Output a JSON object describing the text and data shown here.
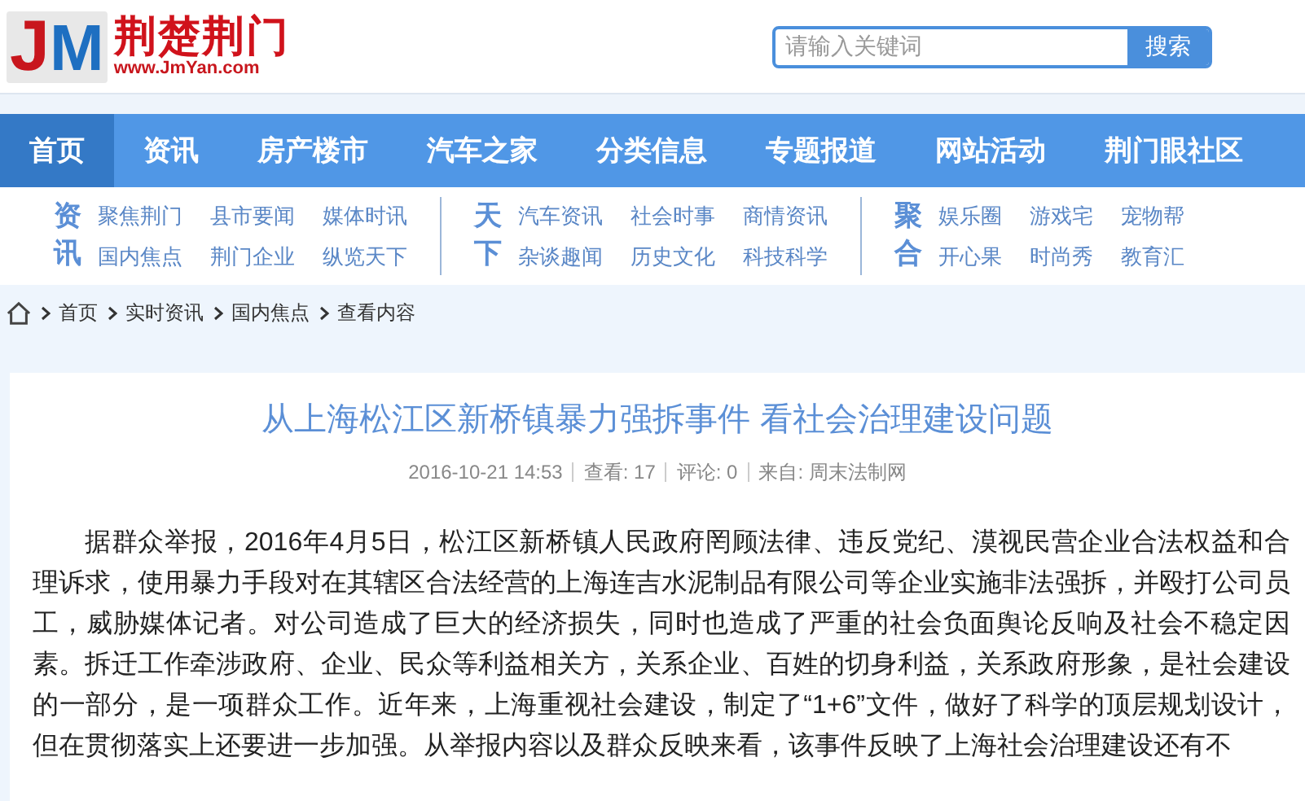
{
  "header": {
    "logo": {
      "mark_letters": [
        "J",
        "M"
      ],
      "name": "荆楚荆门",
      "url": "www.JmYan.com"
    },
    "search": {
      "placeholder": "请输入关键词",
      "button": "搜索"
    }
  },
  "nav": [
    {
      "label": "首页",
      "selected": true
    },
    {
      "label": "资讯",
      "selected": false
    },
    {
      "label": "房产楼市",
      "selected": false
    },
    {
      "label": "汽车之家",
      "selected": false
    },
    {
      "label": "分类信息",
      "selected": false
    },
    {
      "label": "专题报道",
      "selected": false
    },
    {
      "label": "网站活动",
      "selected": false
    },
    {
      "label": "荆门眼社区",
      "selected": false
    }
  ],
  "subnav": [
    {
      "label": "资讯",
      "rows": [
        [
          "聚焦荆门",
          "县市要闻",
          "媒体时讯"
        ],
        [
          "国内焦点",
          "荆门企业",
          "纵览天下"
        ]
      ]
    },
    {
      "label": "天下",
      "rows": [
        [
          "汽车资讯",
          "社会时事",
          "商情资讯"
        ],
        [
          "杂谈趣闻",
          "历史文化",
          "科技科学"
        ]
      ]
    },
    {
      "label": "聚合",
      "rows": [
        [
          "娱乐圈",
          "游戏宅",
          "宠物帮"
        ],
        [
          "开心果",
          "时尚秀",
          "教育汇"
        ]
      ]
    }
  ],
  "breadcrumb": [
    "首页",
    "实时资讯",
    "国内焦点",
    "查看内容"
  ],
  "article": {
    "title": "从上海松江区新桥镇暴力强拆事件 看社会治理建设问题",
    "meta": [
      "2016-10-21 14:53",
      "查看: 17",
      "评论: 0",
      "来自: 周末法制网"
    ],
    "paragraph": "据群众举报，2016年4月5日，松江区新桥镇人民政府罔顾法律、违反党纪、漠视民营企业合法权益和合理诉求，使用暴力手段对在其辖区合法经营的上海连吉水泥制品有限公司等企业实施非法强拆，并殴打公司员工，威胁媒体记者。对公司造成了巨大的经济损失，同时也造成了严重的社会负面舆论反响及社会不稳定因素。拆迁工作牵涉政府、企业、民众等利益相关方，关系企业、百姓的切身利益，关系政府形象，是社会建设的一部分，是一项群众工作。近年来，上海重视社会建设，制定了“1+6”文件，做好了科学的顶层规划设计，但在贯彻落实上还要进一步加强。从举报内容以及群众反映来看，该事件反映了上海社会治理建设还有不"
  }
}
